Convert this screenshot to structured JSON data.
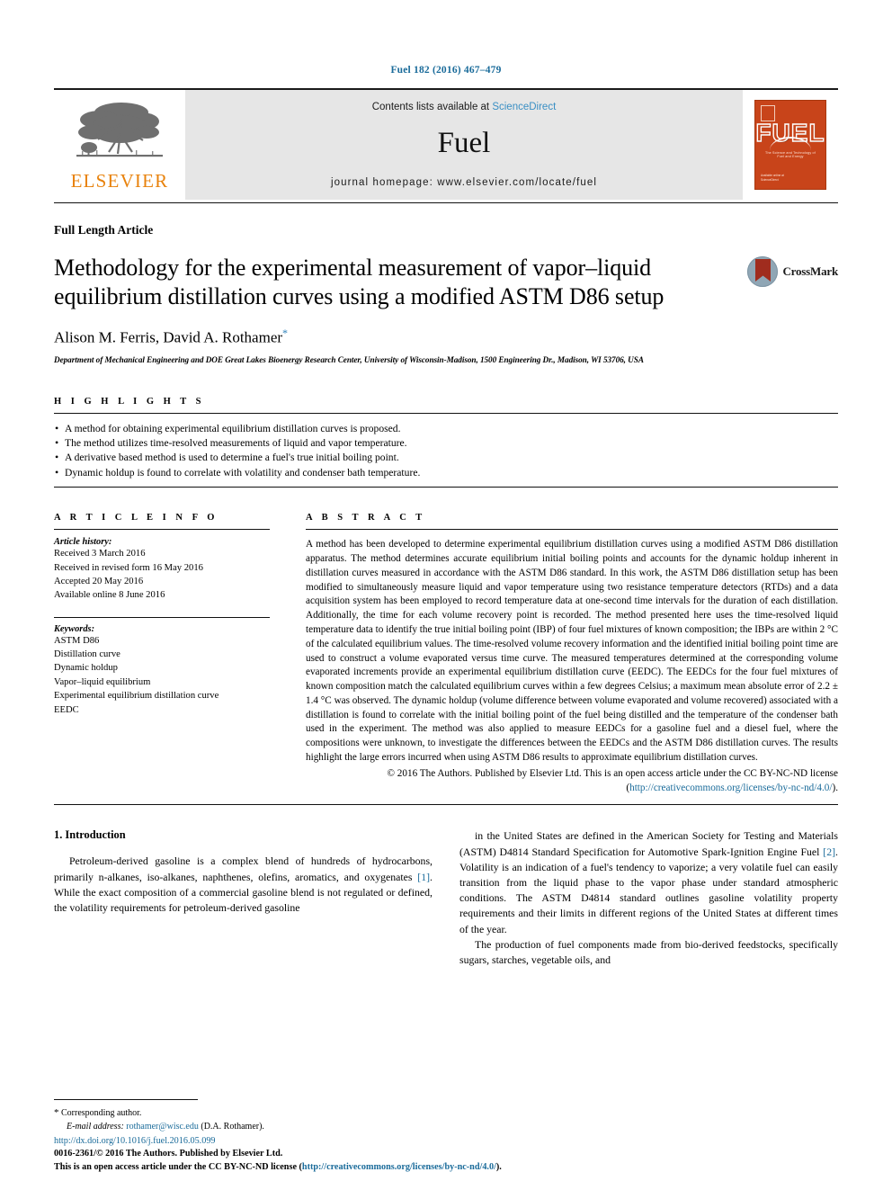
{
  "running_head": "Fuel 182 (2016) 467–479",
  "masthead": {
    "contents_prefix": "Contents lists available at ",
    "sciencedirect": "ScienceDirect",
    "journal_name": "Fuel",
    "homepage": "journal homepage: www.elsevier.com/locate/fuel",
    "publisher_logo_text": "ELSEVIER",
    "cover": {
      "title": "FUEL",
      "subtitle": "The Science and Technology of Fuel and Energy",
      "footer": "Available online at\nScienceDirect"
    }
  },
  "article": {
    "type": "Full Length Article",
    "title": "Methodology for the experimental measurement of vapor–liquid equilibrium distillation curves using a modified ASTM D86 setup",
    "authors": "Alison M. Ferris, David A. Rothamer",
    "corresponding_marker": "*",
    "affiliation": "Department of Mechanical Engineering and DOE Great Lakes Bioenergy Research Center, University of Wisconsin-Madison, 1500 Engineering Dr., Madison, WI 53706, USA",
    "crossmark_label": "CrossMark"
  },
  "highlights": {
    "heading": "H I G H L I G H T S",
    "items": [
      "A method for obtaining experimental equilibrium distillation curves is proposed.",
      "The method utilizes time-resolved measurements of liquid and vapor temperature.",
      "A derivative based method is used to determine a fuel's true initial boiling point.",
      "Dynamic holdup is found to correlate with volatility and condenser bath temperature."
    ]
  },
  "article_info": {
    "heading": "A R T I C L E   I N F O",
    "history_label": "Article history:",
    "history": [
      "Received 3 March 2016",
      "Received in revised form 16 May 2016",
      "Accepted 20 May 2016",
      "Available online 8 June 2016"
    ],
    "keywords_label": "Keywords:",
    "keywords": [
      "ASTM D86",
      "Distillation curve",
      "Dynamic holdup",
      "Vapor–liquid equilibrium",
      "Experimental equilibrium distillation curve",
      "EEDC"
    ]
  },
  "abstract": {
    "heading": "A B S T R A C T",
    "body": "A method has been developed to determine experimental equilibrium distillation curves using a modified ASTM D86 distillation apparatus. The method determines accurate equilibrium initial boiling points and accounts for the dynamic holdup inherent in distillation curves measured in accordance with the ASTM D86 standard. In this work, the ASTM D86 distillation setup has been modified to simultaneously measure liquid and vapor temperature using two resistance temperature detectors (RTDs) and a data acquisition system has been employed to record temperature data at one-second time intervals for the duration of each distillation. Additionally, the time for each volume recovery point is recorded. The method presented here uses the time-resolved liquid temperature data to identify the true initial boiling point (IBP) of four fuel mixtures of known composition; the IBPs are within 2 °C of the calculated equilibrium values. The time-resolved volume recovery information and the identified initial boiling point time are used to construct a volume evaporated versus time curve. The measured temperatures determined at the corresponding volume evaporated increments provide an experimental equilibrium distillation curve (EEDC). The EEDCs for the four fuel mixtures of known composition match the calculated equilibrium curves within a few degrees Celsius; a maximum mean absolute error of 2.2 ± 1.4 °C was observed. The dynamic holdup (volume difference between volume evaporated and volume recovered) associated with a distillation is found to correlate with the initial boiling point of the fuel being distilled and the temperature of the condenser bath used in the experiment. The method was also applied to measure EEDCs for a gasoline fuel and a diesel fuel, where the compositions were unknown, to investigate the differences between the EEDCs and the ASTM D86 distillation curves. The results highlight the large errors incurred when using ASTM D86 results to approximate equilibrium distillation curves.",
    "copyright_line1": "© 2016 The Authors. Published by Elsevier Ltd. This is an open access article under the CC BY-NC-ND",
    "copyright_line2_prefix": "license (",
    "copyright_license_url": "http://creativecommons.org/licenses/by-nc-nd/4.0/",
    "copyright_line2_suffix": ")."
  },
  "body": {
    "section_heading": "1. Introduction",
    "left_paragraph": "Petroleum-derived gasoline is a complex blend of hundreds of hydrocarbons, primarily n-alkanes, iso-alkanes, naphthenes, olefins, aromatics, and oxygenates [1]. While the exact composition of a commercial gasoline blend is not regulated or defined, the volatility requirements for petroleum-derived gasoline",
    "left_ref": "[1]",
    "right_paragraph_1": "in the United States are defined in the American Society for Testing and Materials (ASTM) D4814 Standard Specification for Automotive Spark-Ignition Engine Fuel [2]. Volatility is an indication of a fuel's tendency to vaporize; a very volatile fuel can easily transition from the liquid phase to the vapor phase under standard atmospheric conditions. The ASTM D4814 standard outlines gasoline volatility property requirements and their limits in different regions of the United States at different times of the year.",
    "right_ref": "[2]",
    "right_paragraph_2": "The production of fuel components made from bio-derived feedstocks, specifically sugars, starches, vegetable oils, and"
  },
  "footnote": {
    "star": "*",
    "corresponding": "Corresponding author.",
    "email_label": "E-mail address:",
    "email": "rothamer@wisc.edu",
    "email_owner": "(D.A. Rothamer)."
  },
  "page_footer": {
    "doi": "http://dx.doi.org/10.1016/j.fuel.2016.05.099",
    "issn_line": "0016-2361/© 2016 The Authors. Published by Elsevier Ltd.",
    "oa_prefix": "This is an open access article under the CC BY-NC-ND license (",
    "oa_url": "http://creativecommons.org/licenses/by-nc-nd/4.0/",
    "oa_suffix": ")."
  },
  "colors": {
    "link": "#1a6b9a",
    "elsevier_orange": "#E8820C",
    "cover_orange": "#C8441A",
    "sciencedirect": "#3a8fc4"
  }
}
